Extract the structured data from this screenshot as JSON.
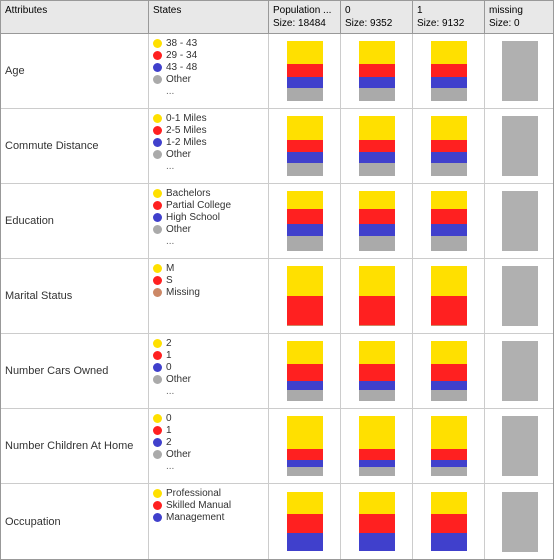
{
  "header": {
    "attributes_label": "Attributes",
    "states_label": "States",
    "pop_label": "Population ...",
    "pop_sub": "Size: 18484",
    "col0_label": "0",
    "col0_sub": "Size: 9352",
    "col1_label": "1",
    "col1_sub": "Size: 9132",
    "missing_label": "missing",
    "missing_sub": "Size: 0"
  },
  "rows": [
    {
      "attribute": "Age",
      "states": [
        {
          "color": "#FFE000",
          "label": "38 - 43"
        },
        {
          "color": "#FF2020",
          "label": "29 - 34"
        },
        {
          "color": "#4040CC",
          "label": "43 - 48"
        },
        {
          "color": "#AAAAAA",
          "label": "Other"
        }
      ],
      "ellipsis": true,
      "pop_chart": [
        {
          "color": "#FFE000",
          "pct": 38
        },
        {
          "color": "#FF2020",
          "pct": 22
        },
        {
          "color": "#4040CC",
          "pct": 18
        },
        {
          "color": "#AAAAAA",
          "pct": 22
        }
      ],
      "col0_chart": [
        {
          "color": "#FFE000",
          "pct": 38
        },
        {
          "color": "#FF2020",
          "pct": 22
        },
        {
          "color": "#4040CC",
          "pct": 18
        },
        {
          "color": "#AAAAAA",
          "pct": 22
        }
      ],
      "col1_chart": [
        {
          "color": "#FFE000",
          "pct": 38
        },
        {
          "color": "#FF2020",
          "pct": 22
        },
        {
          "color": "#4040CC",
          "pct": 18
        },
        {
          "color": "#AAAAAA",
          "pct": 22
        }
      ],
      "missing": true
    },
    {
      "attribute": "Commute Distance",
      "states": [
        {
          "color": "#FFE000",
          "label": "0-1 Miles"
        },
        {
          "color": "#FF2020",
          "label": "2-5 Miles"
        },
        {
          "color": "#4040CC",
          "label": "1-2 Miles"
        },
        {
          "color": "#AAAAAA",
          "label": "Other"
        }
      ],
      "ellipsis": true,
      "pop_chart": [
        {
          "color": "#FFE000",
          "pct": 40
        },
        {
          "color": "#FF2020",
          "pct": 20
        },
        {
          "color": "#4040CC",
          "pct": 18
        },
        {
          "color": "#AAAAAA",
          "pct": 22
        }
      ],
      "col0_chart": [
        {
          "color": "#FFE000",
          "pct": 40
        },
        {
          "color": "#FF2020",
          "pct": 20
        },
        {
          "color": "#4040CC",
          "pct": 18
        },
        {
          "color": "#AAAAAA",
          "pct": 22
        }
      ],
      "col1_chart": [
        {
          "color": "#FFE000",
          "pct": 40
        },
        {
          "color": "#FF2020",
          "pct": 20
        },
        {
          "color": "#4040CC",
          "pct": 18
        },
        {
          "color": "#AAAAAA",
          "pct": 22
        }
      ],
      "missing": true
    },
    {
      "attribute": "Education",
      "states": [
        {
          "color": "#FFE000",
          "label": "Bachelors"
        },
        {
          "color": "#FF2020",
          "label": "Partial College"
        },
        {
          "color": "#4040CC",
          "label": "High School"
        },
        {
          "color": "#AAAAAA",
          "label": "Other"
        }
      ],
      "ellipsis": true,
      "pop_chart": [
        {
          "color": "#FFE000",
          "pct": 30
        },
        {
          "color": "#FF2020",
          "pct": 25
        },
        {
          "color": "#4040CC",
          "pct": 20
        },
        {
          "color": "#AAAAAA",
          "pct": 25
        }
      ],
      "col0_chart": [
        {
          "color": "#FFE000",
          "pct": 30
        },
        {
          "color": "#FF2020",
          "pct": 25
        },
        {
          "color": "#4040CC",
          "pct": 20
        },
        {
          "color": "#AAAAAA",
          "pct": 25
        }
      ],
      "col1_chart": [
        {
          "color": "#FFE000",
          "pct": 30
        },
        {
          "color": "#FF2020",
          "pct": 25
        },
        {
          "color": "#4040CC",
          "pct": 20
        },
        {
          "color": "#AAAAAA",
          "pct": 25
        }
      ],
      "missing": true
    },
    {
      "attribute": "Marital Status",
      "states": [
        {
          "color": "#FFE000",
          "label": "M"
        },
        {
          "color": "#FF2020",
          "label": "S"
        },
        {
          "color": "#CC8866",
          "label": "Missing"
        }
      ],
      "ellipsis": false,
      "pop_chart": [
        {
          "color": "#FFE000",
          "pct": 50
        },
        {
          "color": "#FF2020",
          "pct": 48
        },
        {
          "color": "#CC8866",
          "pct": 2
        }
      ],
      "col0_chart": [
        {
          "color": "#FFE000",
          "pct": 50
        },
        {
          "color": "#FF2020",
          "pct": 48
        },
        {
          "color": "#CC8866",
          "pct": 2
        }
      ],
      "col1_chart": [
        {
          "color": "#FFE000",
          "pct": 50
        },
        {
          "color": "#FF2020",
          "pct": 48
        },
        {
          "color": "#CC8866",
          "pct": 2
        }
      ],
      "missing": true
    },
    {
      "attribute": "Number Cars Owned",
      "states": [
        {
          "color": "#FFE000",
          "label": "2"
        },
        {
          "color": "#FF2020",
          "label": "1"
        },
        {
          "color": "#4040CC",
          "label": "0"
        },
        {
          "color": "#AAAAAA",
          "label": "Other"
        }
      ],
      "ellipsis": true,
      "pop_chart": [
        {
          "color": "#FFE000",
          "pct": 38
        },
        {
          "color": "#FF2020",
          "pct": 28
        },
        {
          "color": "#4040CC",
          "pct": 15
        },
        {
          "color": "#AAAAAA",
          "pct": 19
        }
      ],
      "col0_chart": [
        {
          "color": "#FFE000",
          "pct": 38
        },
        {
          "color": "#FF2020",
          "pct": 28
        },
        {
          "color": "#4040CC",
          "pct": 15
        },
        {
          "color": "#AAAAAA",
          "pct": 19
        }
      ],
      "col1_chart": [
        {
          "color": "#FFE000",
          "pct": 38
        },
        {
          "color": "#FF2020",
          "pct": 28
        },
        {
          "color": "#4040CC",
          "pct": 15
        },
        {
          "color": "#AAAAAA",
          "pct": 19
        }
      ],
      "missing": true
    },
    {
      "attribute": "Number Children At Home",
      "states": [
        {
          "color": "#FFE000",
          "label": "0"
        },
        {
          "color": "#FF2020",
          "label": "1"
        },
        {
          "color": "#4040CC",
          "label": "2"
        },
        {
          "color": "#AAAAAA",
          "label": "Other"
        }
      ],
      "ellipsis": true,
      "pop_chart": [
        {
          "color": "#FFE000",
          "pct": 55
        },
        {
          "color": "#FF2020",
          "pct": 18
        },
        {
          "color": "#4040CC",
          "pct": 12
        },
        {
          "color": "#AAAAAA",
          "pct": 15
        }
      ],
      "col0_chart": [
        {
          "color": "#FFE000",
          "pct": 55
        },
        {
          "color": "#FF2020",
          "pct": 18
        },
        {
          "color": "#4040CC",
          "pct": 12
        },
        {
          "color": "#AAAAAA",
          "pct": 15
        }
      ],
      "col1_chart": [
        {
          "color": "#FFE000",
          "pct": 55
        },
        {
          "color": "#FF2020",
          "pct": 18
        },
        {
          "color": "#4040CC",
          "pct": 12
        },
        {
          "color": "#AAAAAA",
          "pct": 15
        }
      ],
      "missing": true
    },
    {
      "attribute": "Occupation",
      "states": [
        {
          "color": "#FFE000",
          "label": "Professional"
        },
        {
          "color": "#FF2020",
          "label": "Skilled Manual"
        },
        {
          "color": "#4040CC",
          "label": "Management"
        }
      ],
      "ellipsis": false,
      "pop_chart": [
        {
          "color": "#FFE000",
          "pct": 38
        },
        {
          "color": "#FF2020",
          "pct": 32
        },
        {
          "color": "#4040CC",
          "pct": 30
        }
      ],
      "col0_chart": [
        {
          "color": "#FFE000",
          "pct": 38
        },
        {
          "color": "#FF2020",
          "pct": 32
        },
        {
          "color": "#4040CC",
          "pct": 30
        }
      ],
      "col1_chart": [
        {
          "color": "#FFE000",
          "pct": 38
        },
        {
          "color": "#FF2020",
          "pct": 32
        },
        {
          "color": "#4040CC",
          "pct": 30
        }
      ],
      "missing": true
    }
  ]
}
